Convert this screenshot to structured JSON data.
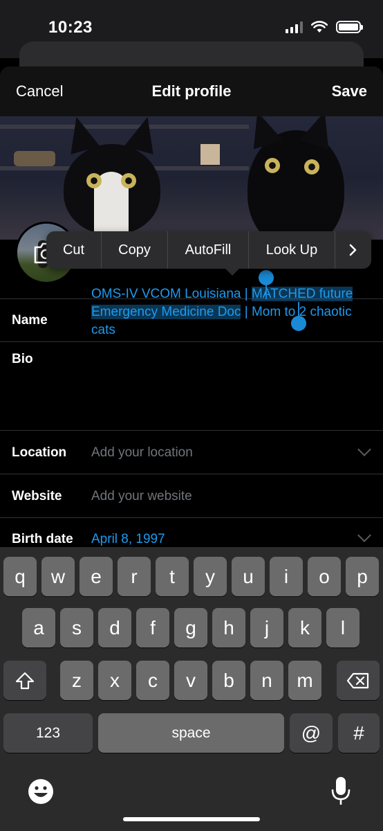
{
  "status_bar": {
    "time": "10:23"
  },
  "nav": {
    "cancel": "Cancel",
    "title": "Edit profile",
    "save": "Save"
  },
  "edit_menu": {
    "items": [
      "Cut",
      "Copy",
      "AutoFill",
      "Look Up"
    ]
  },
  "fields": {
    "name": {
      "label": "Name"
    },
    "bio": {
      "label": "Bio",
      "text_before": "OMS-IV VCOM Louisiana | ",
      "selected": "MATCHED future Emergency Medicine Doc",
      "text_after": " | Mom to 2 chaotic cats"
    },
    "location": {
      "label": "Location",
      "placeholder": "Add your location"
    },
    "website": {
      "label": "Website",
      "placeholder": "Add your website"
    },
    "birth_date": {
      "label": "Birth date",
      "value": "April 8, 1997"
    }
  },
  "keyboard": {
    "row1": [
      "q",
      "w",
      "e",
      "r",
      "t",
      "y",
      "u",
      "i",
      "o",
      "p"
    ],
    "row2": [
      "a",
      "s",
      "d",
      "f",
      "g",
      "h",
      "j",
      "k",
      "l"
    ],
    "row3": [
      "z",
      "x",
      "c",
      "v",
      "b",
      "n",
      "m"
    ],
    "numbers_key": "123",
    "space_key": "space",
    "at_key": "@",
    "hash_key": "#"
  },
  "colors": {
    "accent": "#1d9bf0",
    "background": "#000000",
    "keyboard": "#2b2b2b"
  }
}
